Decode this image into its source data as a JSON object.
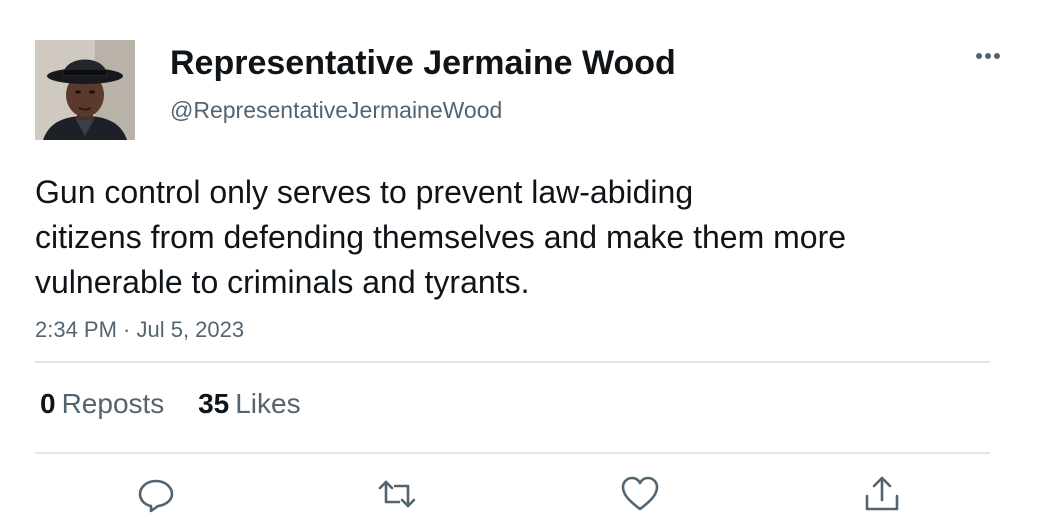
{
  "author": {
    "display_name": "Representative Jermaine Wood",
    "handle": "@RepresentativeJermaineWood",
    "avatar": "avatar-photo"
  },
  "tweet": {
    "text_lines": [
      "Gun control only serves to prevent law-abiding",
      "citizens from defending themselves and make them more",
      "vulnerable to criminals and tyrants."
    ],
    "timestamp": "2:34 PM · Jul 5, 2023"
  },
  "stats": {
    "reposts_count": "0",
    "reposts_label": "Reposts",
    "likes_count": "35",
    "likes_label": "Likes"
  },
  "actions": [
    "reply-icon",
    "repost-icon",
    "like-icon",
    "share-icon"
  ],
  "colors": {
    "text_primary": "#0f1419",
    "text_secondary": "#536471",
    "divider": "#e1e5e8"
  }
}
